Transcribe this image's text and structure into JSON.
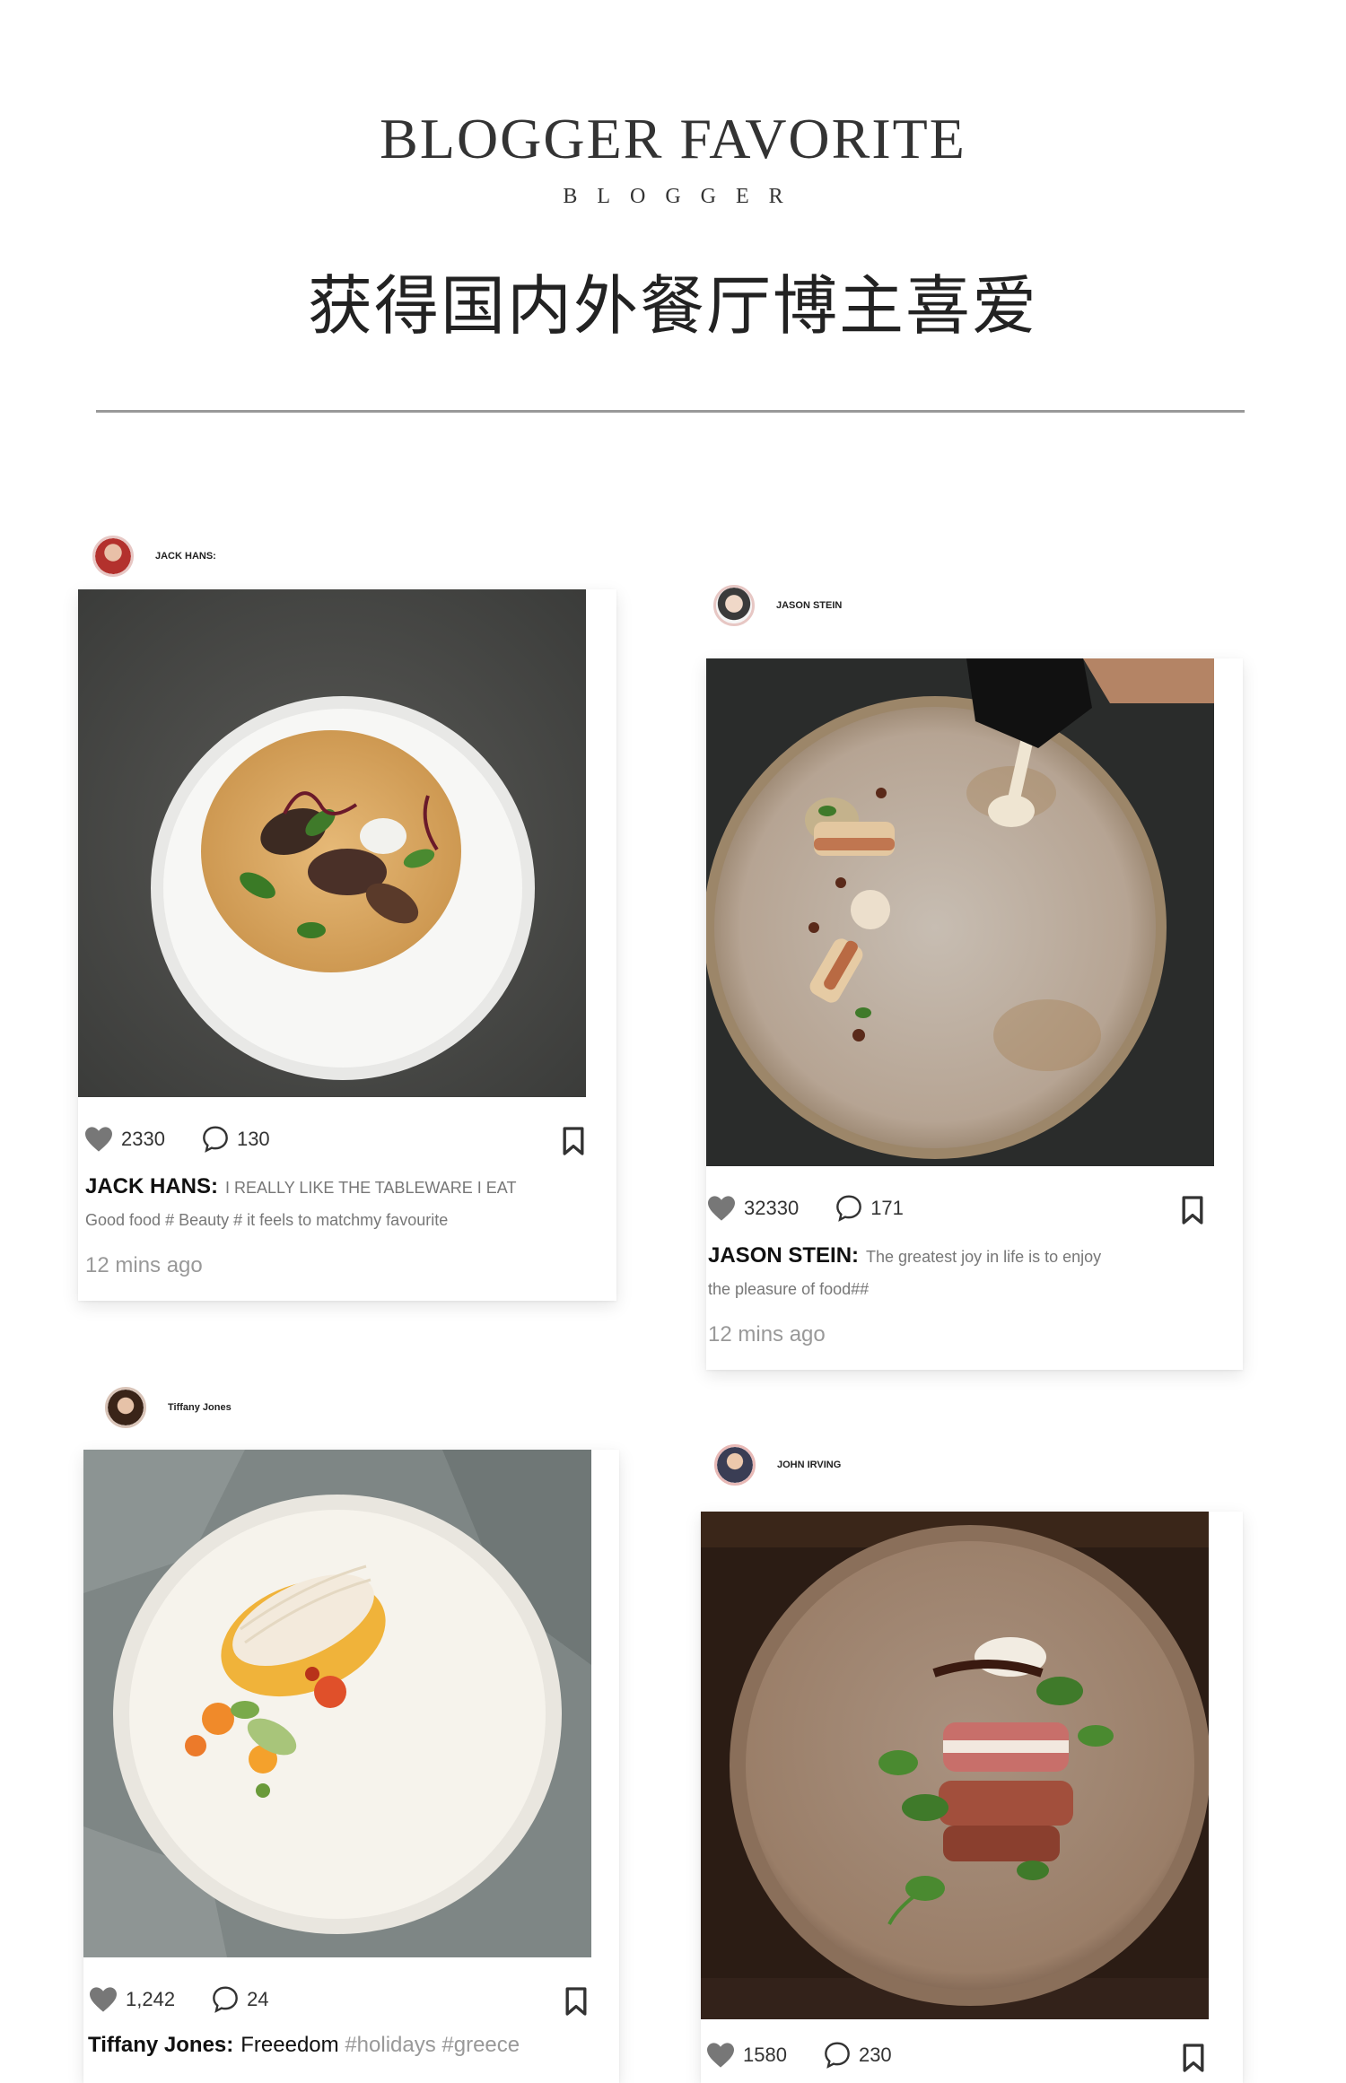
{
  "header": {
    "title": "BLOGGER FAVORITE",
    "subtitle": "BLOGGER",
    "cn_title": "获得国内外餐厅博主喜爱"
  },
  "posts": [
    {
      "author": "JACK HANS:",
      "likes": "2330",
      "comments": "130",
      "caption_name": "JACK HANS:",
      "caption_text": "I REALLY LIKE THE TABLEWARE I EAT",
      "caption_line2": "Good food # Beauty #   it feels to matchmy favourite",
      "time": "12 mins ago"
    },
    {
      "author": "JASON STEIN",
      "likes": "32330",
      "comments": "171",
      "caption_name": "JASON STEIN:",
      "caption_text": "The greatest joy in life is to enjoy",
      "caption_line2": "the pleasure of food##",
      "time": "12 mins ago"
    },
    {
      "author": "Tiffany Jones",
      "likes": "1,242",
      "comments": "24",
      "caption_name": "Tiffany Jones:",
      "caption_text": "Freeedom",
      "caption_tags": "#holidays #greece"
    },
    {
      "author": "JOHN IRVING",
      "likes": "1580",
      "comments": "230"
    }
  ],
  "icons": {
    "like": "heart-icon",
    "comment": "comment-bubble-icon",
    "save": "bookmark-icon"
  },
  "colors": {
    "heart": "#777777",
    "divider": "#999999",
    "avatar_ring": "#e7c7c4"
  }
}
